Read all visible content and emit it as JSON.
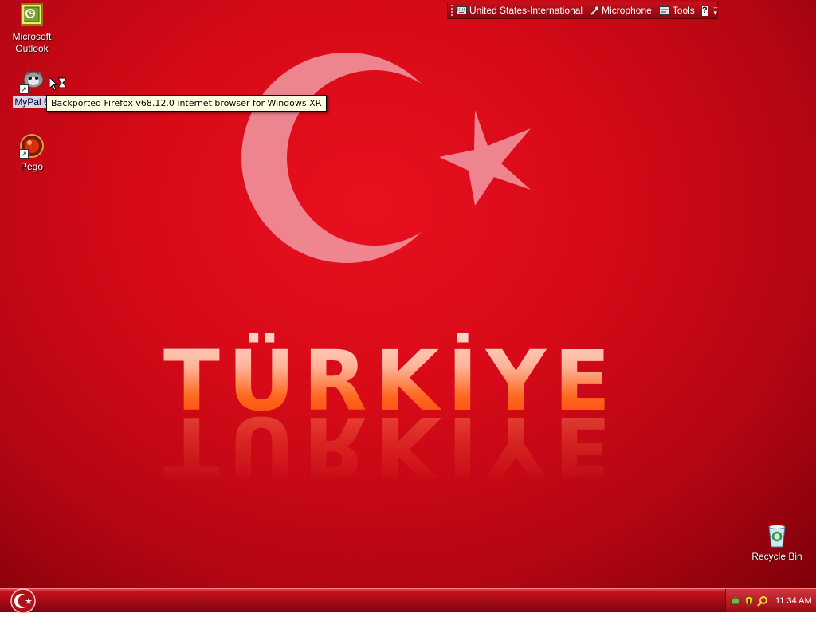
{
  "desktop": {
    "wallpaper_text": "TÜRKİYE",
    "icons": [
      {
        "label_line1": "Microsoft",
        "label_line2": "Outlook"
      },
      {
        "label": "MyPal 6"
      },
      {
        "label": "Pego"
      },
      {
        "label": "Recycle Bin"
      }
    ],
    "tooltip": "Backported Firefox v68.12.0 internet browser for Windows XP."
  },
  "language_bar": {
    "language": "United States-International",
    "microphone": "Microphone",
    "tools": "Tools",
    "help": "?"
  },
  "taskbar": {
    "clock": "11:34 AM"
  },
  "colors": {
    "desktop_red": "#d80a18",
    "taskbar_red": "#a20a15",
    "tooltip_bg": "#ffffe1"
  }
}
